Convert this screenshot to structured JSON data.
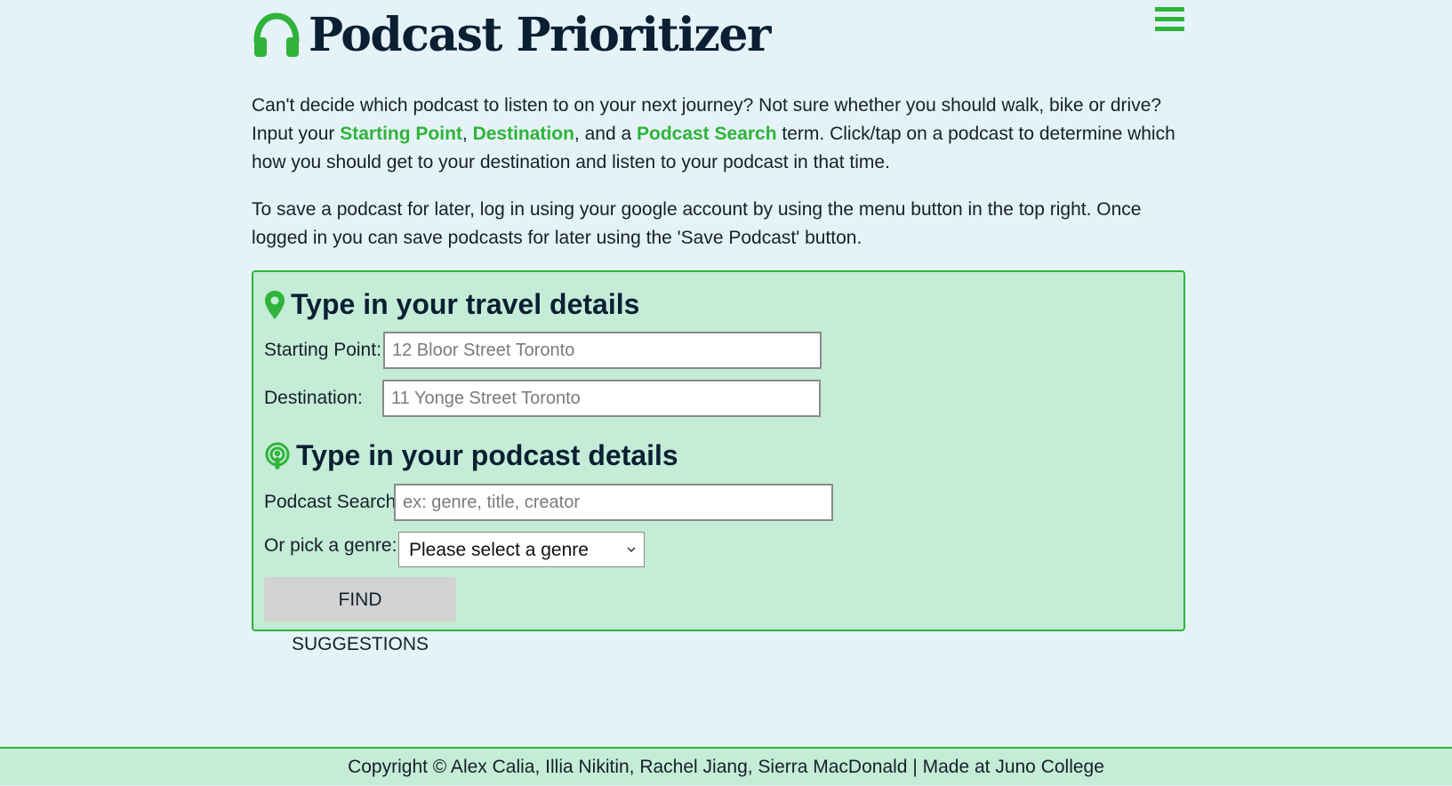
{
  "header": {
    "title": "Podcast Prioritizer",
    "logo_icon": "headphones-icon",
    "menu_icon": "hamburger-menu-icon"
  },
  "intro": {
    "p1_before": "Can't decide which podcast to listen to on your next journey? Not sure whether you should walk, bike or drive? Input your ",
    "starting_point": "Starting Point",
    "sep1": ", ",
    "destination": "Destination",
    "sep2": ", and a ",
    "podcast_search": "Podcast Search",
    "p1_after": " term. Click/tap on a podcast to determine which how you should get to your destination and listen to your podcast in that time.",
    "p2": "To save a podcast for later, log in using your google account by using the menu button in the top right. Once logged in you can save podcasts for later using the 'Save Podcast' button."
  },
  "travel": {
    "heading": "Type in your travel details",
    "icon": "map-pin-icon",
    "start_label": "Starting Point:",
    "start_placeholder": "12 Bloor Street Toronto",
    "dest_label": "Destination:",
    "dest_placeholder": "11 Yonge Street Toronto"
  },
  "podcast": {
    "heading": "Type in your podcast details",
    "icon": "podcast-icon",
    "search_label": "Podcast Search:",
    "search_placeholder": "ex: genre, title, creator",
    "genre_label": "Or pick a genre:",
    "genre_selected": "Please select a genre",
    "button_label": "FIND SUGGESTIONS"
  },
  "footer": {
    "text": "Copyright © Alex Calia, Illia Nikitin, Rachel Jiang, Sierra MacDonald | Made at Juno College"
  },
  "colors": {
    "accent": "#2fb33a",
    "background": "#e5f3f8",
    "card": "#c4ecd6",
    "heading": "#0b1f33"
  }
}
